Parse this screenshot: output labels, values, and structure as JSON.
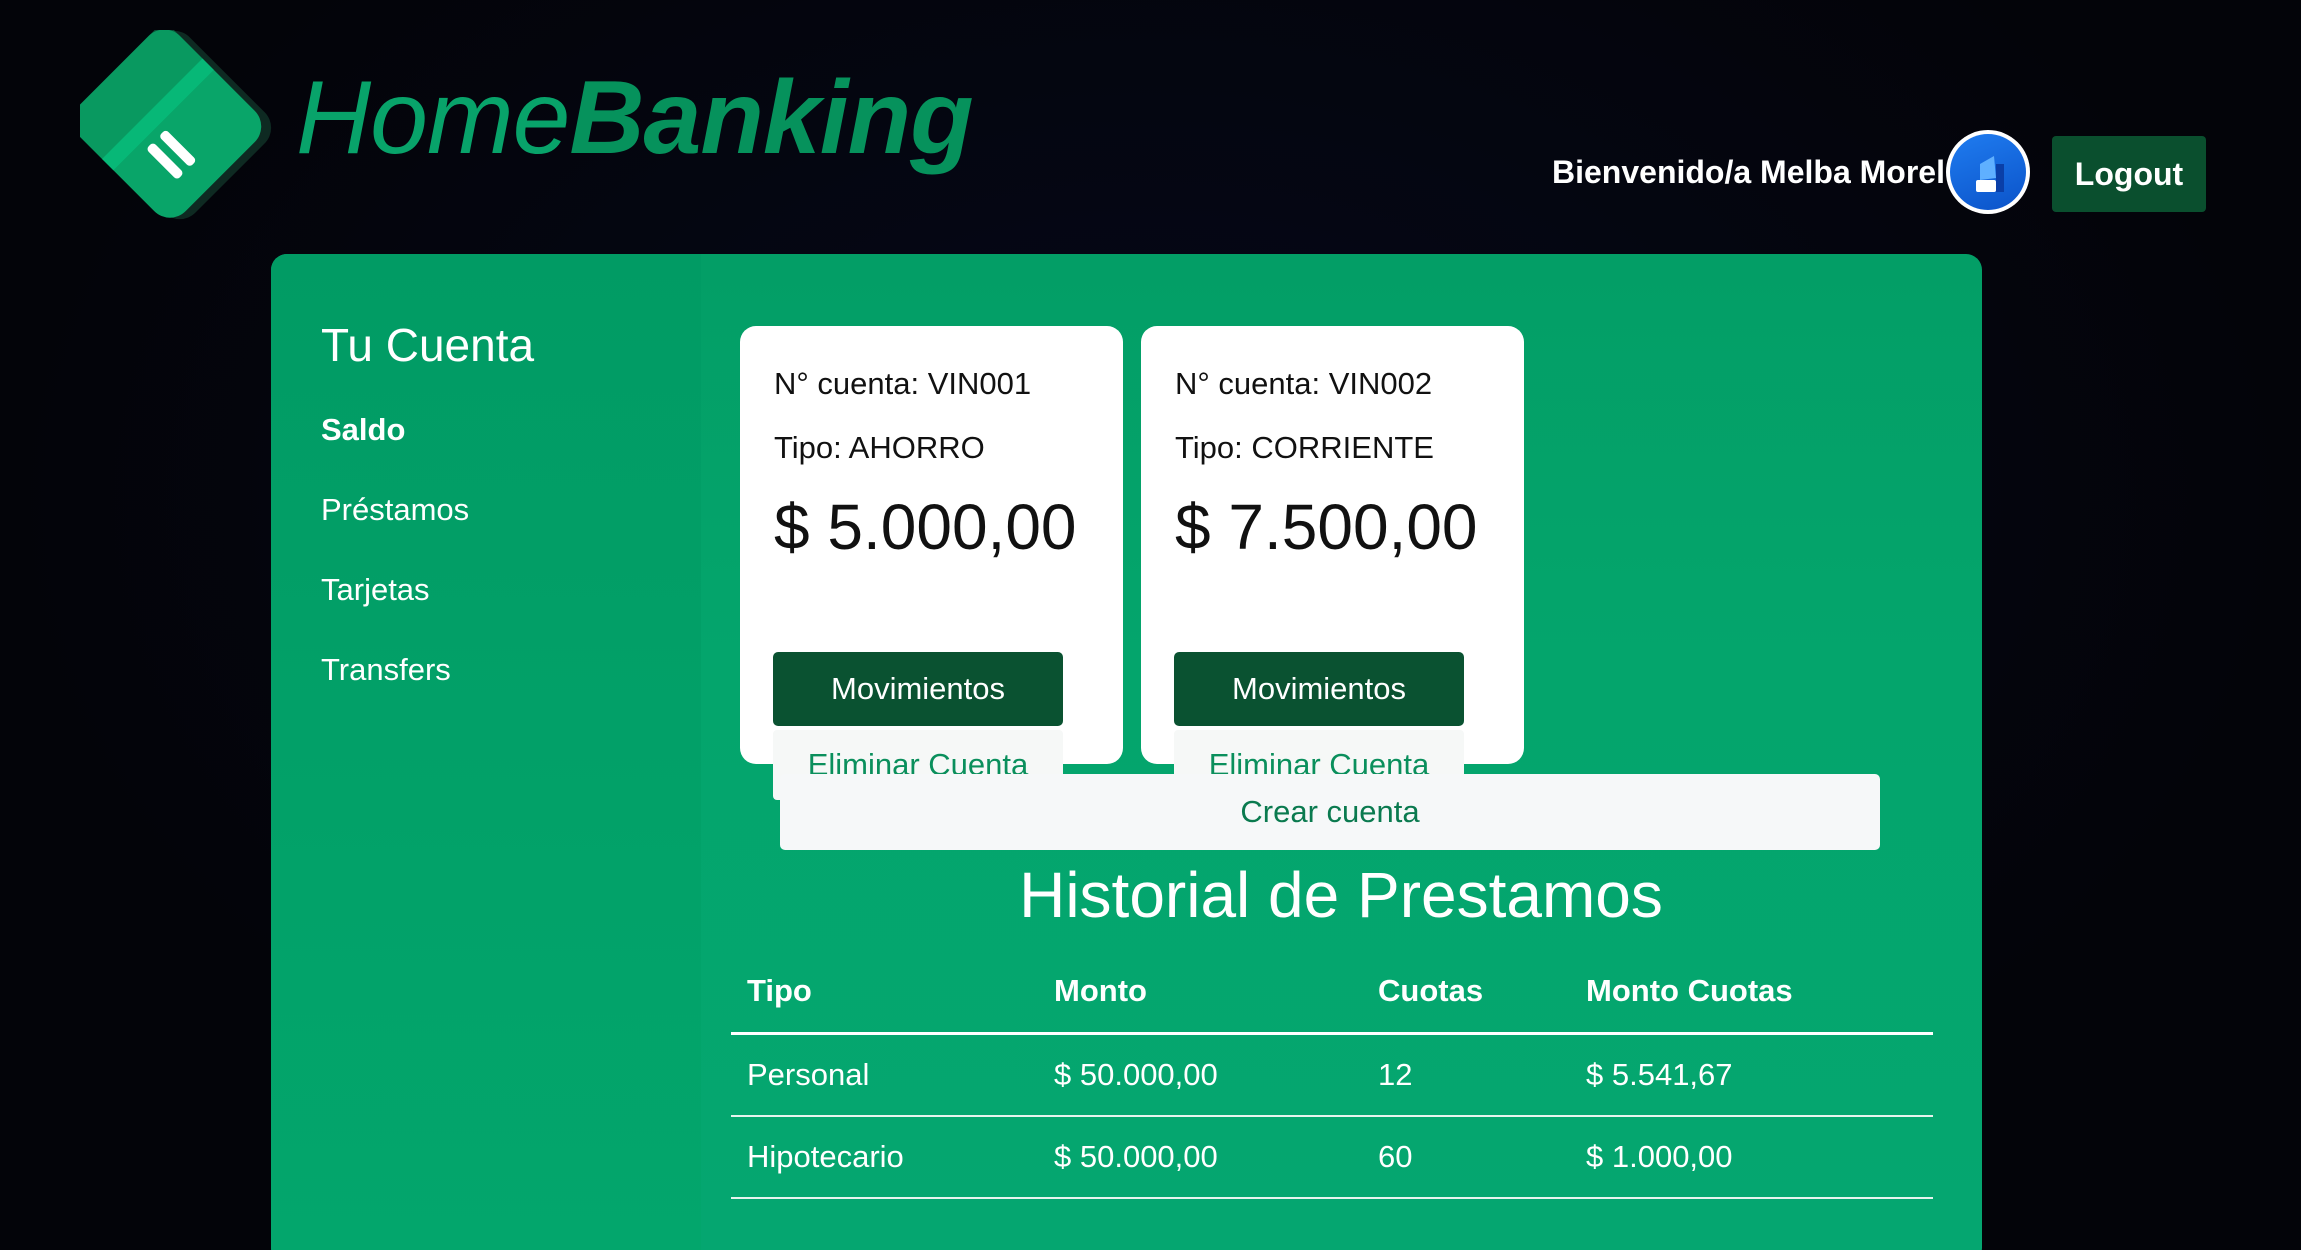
{
  "header": {
    "brand_part1": "Home",
    "brand_part2": "Banking",
    "welcome_text": "Bienvenido/a Melba Morel",
    "logout_label": "Logout"
  },
  "sidebar": {
    "title": "Tu Cuenta",
    "items": [
      {
        "label": "Saldo",
        "active": true
      },
      {
        "label": "Préstamos",
        "active": false
      },
      {
        "label": "Tarjetas",
        "active": false
      },
      {
        "label": "Transfers",
        "active": false
      }
    ]
  },
  "accounts": [
    {
      "number": "N° cuenta: VIN001",
      "type": "Tipo: AHORRO",
      "balance": "$ 5.000,00",
      "movements_label": "Movimientos",
      "delete_label": "Eliminar Cuenta"
    },
    {
      "number": "N° cuenta: VIN002",
      "type": "Tipo: CORRIENTE",
      "balance": "$ 7.500,00",
      "movements_label": "Movimientos",
      "delete_label": "Eliminar Cuenta"
    }
  ],
  "create_account_label": "Crear cuenta",
  "loans": {
    "title": "Historial de Prestamos",
    "columns": [
      "Tipo",
      "Monto",
      "Cuotas",
      "Monto Cuotas"
    ],
    "rows": [
      [
        "Personal",
        "$ 50.000,00",
        "12",
        "$ 5.541,67"
      ],
      [
        "Hipotecario",
        "$ 50.000,00",
        "60",
        "$ 1.000,00"
      ]
    ]
  },
  "colors": {
    "page_background": "#04050d",
    "panel_green": "#04a56c",
    "button_dark_green": "#0a5231",
    "brand_green": "#08a36a"
  },
  "icons": {
    "logo": "credit-card-logo",
    "avatar": "user-avatar"
  }
}
